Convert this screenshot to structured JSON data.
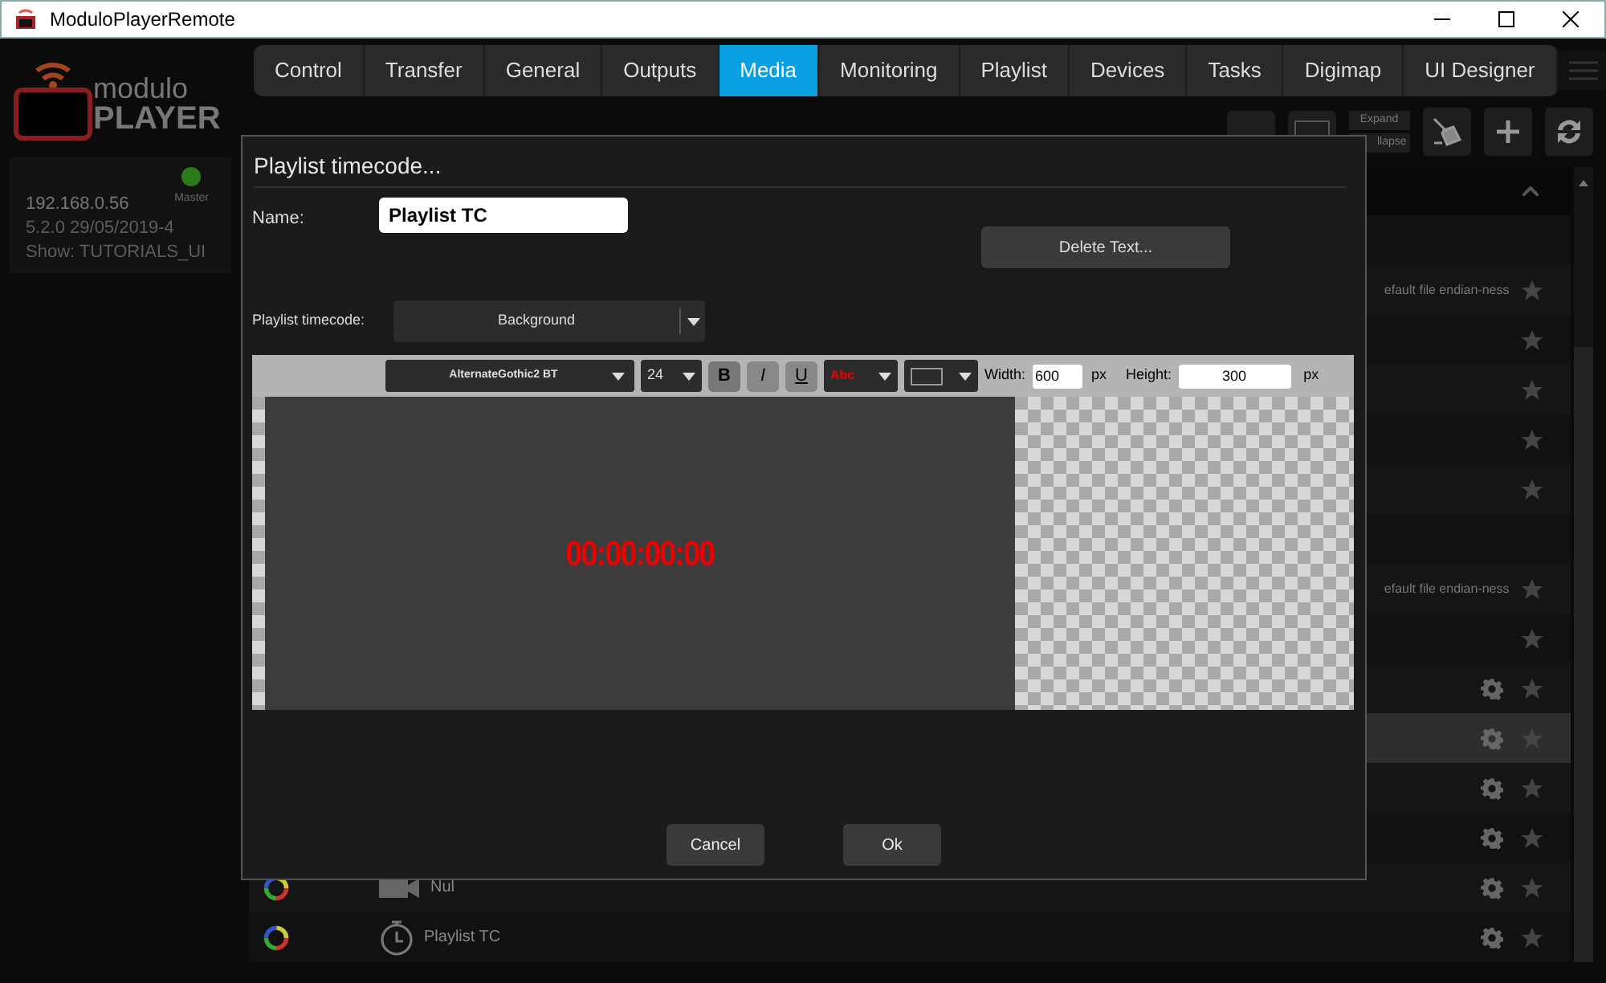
{
  "window": {
    "title": "ModuloPlayerRemote"
  },
  "logo": {
    "line1": "modulo",
    "line2": "PLAYER"
  },
  "server": {
    "status_label": "Master",
    "online": true,
    "ip": "192.168.0.56",
    "version": "5.2.0 29/05/2019-4",
    "show": "Show: TUTORIALS_UI"
  },
  "tabs": [
    {
      "label": "Control",
      "selected": false
    },
    {
      "label": "Transfer",
      "selected": false
    },
    {
      "label": "General",
      "selected": false
    },
    {
      "label": "Outputs",
      "selected": false
    },
    {
      "label": "Media",
      "selected": true
    },
    {
      "label": "Monitoring",
      "selected": false
    },
    {
      "label": "Playlist",
      "selected": false
    },
    {
      "label": "Devices",
      "selected": false
    },
    {
      "label": "Tasks",
      "selected": false
    },
    {
      "label": "Digimap",
      "selected": false
    },
    {
      "label": "UI Designer",
      "selected": false
    }
  ],
  "toolbar": {
    "expand": "Expand",
    "collapse": "llapse"
  },
  "media_rows": [
    {
      "selected": false,
      "star": false,
      "gear": false
    },
    {
      "note": "efault file endian-ness",
      "selected": false,
      "star": true,
      "gear": false
    },
    {
      "selected": false,
      "star": true,
      "gear": false
    },
    {
      "selected": false,
      "star": true,
      "gear": false
    },
    {
      "selected": false,
      "star": true,
      "gear": false
    },
    {
      "selected": false,
      "star": true,
      "gear": false
    },
    {
      "selected": false,
      "star": false,
      "gear": false
    },
    {
      "note": "efault file endian-ness",
      "selected": false,
      "star": true,
      "gear": false
    },
    {
      "selected": false,
      "star": true,
      "gear": false
    },
    {
      "selected": false,
      "star": true,
      "gear": true
    },
    {
      "selected": true,
      "star": true,
      "gear": true
    },
    {
      "selected": false,
      "star": true,
      "gear": true
    },
    {
      "selected": false,
      "star": true,
      "gear": true
    },
    {
      "label": "Nul",
      "kind": "camera",
      "selected": false,
      "star": true,
      "gear": true
    },
    {
      "label": "Playlist TC",
      "kind": "timer",
      "selected": false,
      "star": true,
      "gear": true
    }
  ],
  "dialog": {
    "title": "Playlist timecode...",
    "name_label": "Name:",
    "name_value": "Playlist TC",
    "delete_button": "Delete Text...",
    "timecode_label": "Playlist timecode:",
    "timecode_value": "Background",
    "editor": {
      "font": "AlternateGothic2 BT",
      "size": "24",
      "bold": "B",
      "italic": "I",
      "underline": "U",
      "color_sample": "Abc",
      "width_label": "Width:",
      "width_value": "600",
      "width_unit": "px",
      "height_label": "Height:",
      "height_value": "300",
      "height_unit": "px",
      "preview_text": "00:00:00:00"
    },
    "buttons": [
      "Cancel",
      "Ok"
    ]
  }
}
